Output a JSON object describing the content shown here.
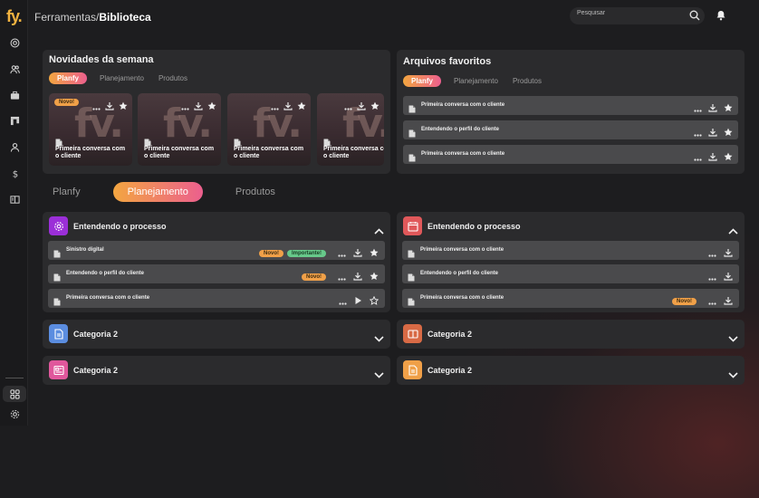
{
  "app": {
    "logo": "fy."
  },
  "breadcrumb": {
    "parent": "Ferramentas/",
    "current": "Biblioteca"
  },
  "search": {
    "placeholder": "Pesquisar"
  },
  "weekly": {
    "title": "Novidades da semana",
    "tabs": [
      "Planfy",
      "Planejamento",
      "Produtos"
    ],
    "active_tab": "Planfy",
    "badge": "Novo!",
    "items": [
      {
        "title": "Primeira conversa com o cliente",
        "thumb_text": "fv."
      },
      {
        "title": "Primeira conversa com o cliente",
        "thumb_text": "fv."
      },
      {
        "title": "Primeira conversa com o cliente",
        "thumb_text": "fv."
      },
      {
        "title": "Primeira conversa com o cliente",
        "thumb_text": "fv."
      }
    ]
  },
  "favorites": {
    "title": "Arquivos favoritos",
    "tabs": [
      "Planfy",
      "Planejamento",
      "Produtos"
    ],
    "items": [
      "Primeira conversa com o cliente",
      "Entendendo o perfil do cliente",
      "Primeira conversa com o cliente"
    ]
  },
  "main_tabs": [
    "Planfy",
    "Planejamento",
    "Produtos"
  ],
  "main_active": "Planejamento",
  "left_sections": [
    {
      "title": "Entendendo o processo",
      "icon": "gear-icon",
      "color": "#9b2fd8",
      "expanded": true,
      "rows": [
        {
          "label": "Sinistro digital",
          "badges": [
            "Novo!",
            "Importante!"
          ]
        },
        {
          "label": "Entendendo o perfil do cliente",
          "badges": [
            "Novo!"
          ]
        },
        {
          "label": "Primeira conversa com o cliente",
          "badges": []
        }
      ]
    },
    {
      "title": "Categoria 2",
      "icon": "document-icon",
      "color": "#5b8de0"
    },
    {
      "title": "Categoria 2",
      "icon": "presentation-icon",
      "color": "#e0579c"
    }
  ],
  "right_sections": [
    {
      "title": "Entendendo o processo",
      "icon": "calendar-icon",
      "color": "#e0585a",
      "expanded": true,
      "rows": [
        {
          "label": "Primeira conversa com o cliente",
          "badges": []
        },
        {
          "label": "Entendendo o perfil do cliente",
          "badges": []
        },
        {
          "label": "Primeira conversa com o cliente",
          "badges": [
            "Novo!"
          ]
        }
      ]
    },
    {
      "title": "Categoria 2",
      "icon": "book-icon",
      "color": "#d86a45"
    },
    {
      "title": "Categoria 2",
      "icon": "document-icon",
      "color": "#f0a048"
    }
  ],
  "colors": {
    "accent_start": "#f3a640",
    "accent_end": "#ec5f8e",
    "badge_new": "#f0a048",
    "badge_important": "#67c98a"
  }
}
